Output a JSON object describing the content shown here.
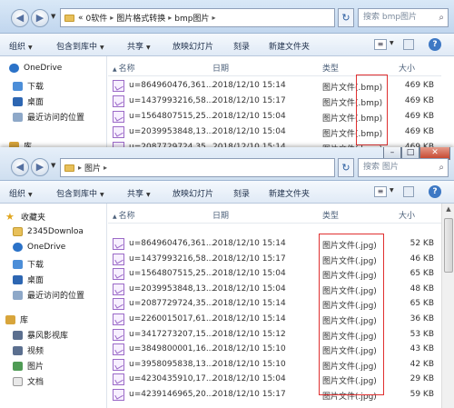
{
  "window1": {
    "breadcrumb": [
      "«",
      "0软件",
      "图片格式转换",
      "bmp图片"
    ],
    "search_placeholder": "搜索 bmp图片",
    "toolbar": [
      "组织",
      "包含到库中",
      "共享",
      "放映幻灯片",
      "刻录",
      "新建文件夹"
    ],
    "nav_items": [
      "OneDrive",
      "下载",
      "桌面",
      "最近访问的位置",
      "库"
    ],
    "columns": {
      "name": "名称",
      "date": "日期",
      "type": "类型",
      "size": "大小"
    },
    "rows": [
      {
        "name": "u=864960476,361...",
        "date": "2018/12/10 15:14",
        "type": "图片文件(.bmp)",
        "size": "469 KB"
      },
      {
        "name": "u=1437993216,58...",
        "date": "2018/12/10 15:17",
        "type": "图片文件(.bmp)",
        "size": "469 KB"
      },
      {
        "name": "u=1564807515,25...",
        "date": "2018/12/10 15:04",
        "type": "图片文件(.bmp)",
        "size": "469 KB"
      },
      {
        "name": "u=2039953848,13...",
        "date": "2018/12/10 15:04",
        "type": "图片文件(.bmp)",
        "size": "469 KB"
      },
      {
        "name": "u=2087729724,35...",
        "date": "2018/12/10 15:14",
        "type": "图片文件(.bmp)",
        "size": "469 KB"
      }
    ]
  },
  "window2": {
    "breadcrumb": [
      "图片"
    ],
    "search_placeholder": "搜索 图片",
    "toolbar": [
      "组织",
      "包含到库中",
      "共享",
      "放映幻灯片",
      "刻录",
      "新建文件夹"
    ],
    "nav_items": [
      "收藏夹",
      "2345Downloa",
      "OneDrive",
      "下载",
      "桌面",
      "最近访问的位置",
      "库",
      "暴风影视库",
      "视频",
      "图片",
      "文档"
    ],
    "columns": {
      "name": "名称",
      "date": "日期",
      "type": "类型",
      "size": "大小"
    },
    "rows": [
      {
        "name": "u=864960476,361...",
        "date": "2018/12/10 15:14",
        "type": "图片文件(.jpg)",
        "size": "52 KB"
      },
      {
        "name": "u=1437993216,58...",
        "date": "2018/12/10 15:17",
        "type": "图片文件(.jpg)",
        "size": "46 KB"
      },
      {
        "name": "u=1564807515,25...",
        "date": "2018/12/10 15:04",
        "type": "图片文件(.jpg)",
        "size": "65 KB"
      },
      {
        "name": "u=2039953848,13...",
        "date": "2018/12/10 15:04",
        "type": "图片文件(.jpg)",
        "size": "48 KB"
      },
      {
        "name": "u=2087729724,35...",
        "date": "2018/12/10 15:14",
        "type": "图片文件(.jpg)",
        "size": "65 KB"
      },
      {
        "name": "u=2260015017,61...",
        "date": "2018/12/10 15:14",
        "type": "图片文件(.jpg)",
        "size": "36 KB"
      },
      {
        "name": "u=3417273207,15...",
        "date": "2018/12/10 15:12",
        "type": "图片文件(.jpg)",
        "size": "53 KB"
      },
      {
        "name": "u=3849800001,16...",
        "date": "2018/12/10 15:10",
        "type": "图片文件(.jpg)",
        "size": "43 KB"
      },
      {
        "name": "u=3958095838,13...",
        "date": "2018/12/10 15:10",
        "type": "图片文件(.jpg)",
        "size": "42 KB"
      },
      {
        "name": "u=4230435910,17...",
        "date": "2018/12/10 15:04",
        "type": "图片文件(.jpg)",
        "size": "29 KB"
      },
      {
        "name": "u=4239146965,20...",
        "date": "2018/12/10 15:17",
        "type": "图片文件(.jpg)",
        "size": "59 KB"
      }
    ]
  },
  "icons": {
    "back": "back-arrow-icon",
    "forward": "forward-arrow-icon",
    "refresh": "refresh-icon",
    "search": "search-icon",
    "help": "help-icon"
  },
  "colors": {
    "highlight": "#e03030",
    "address_bar": "#c1d6ee",
    "file_icon": "#9b6ac7"
  }
}
